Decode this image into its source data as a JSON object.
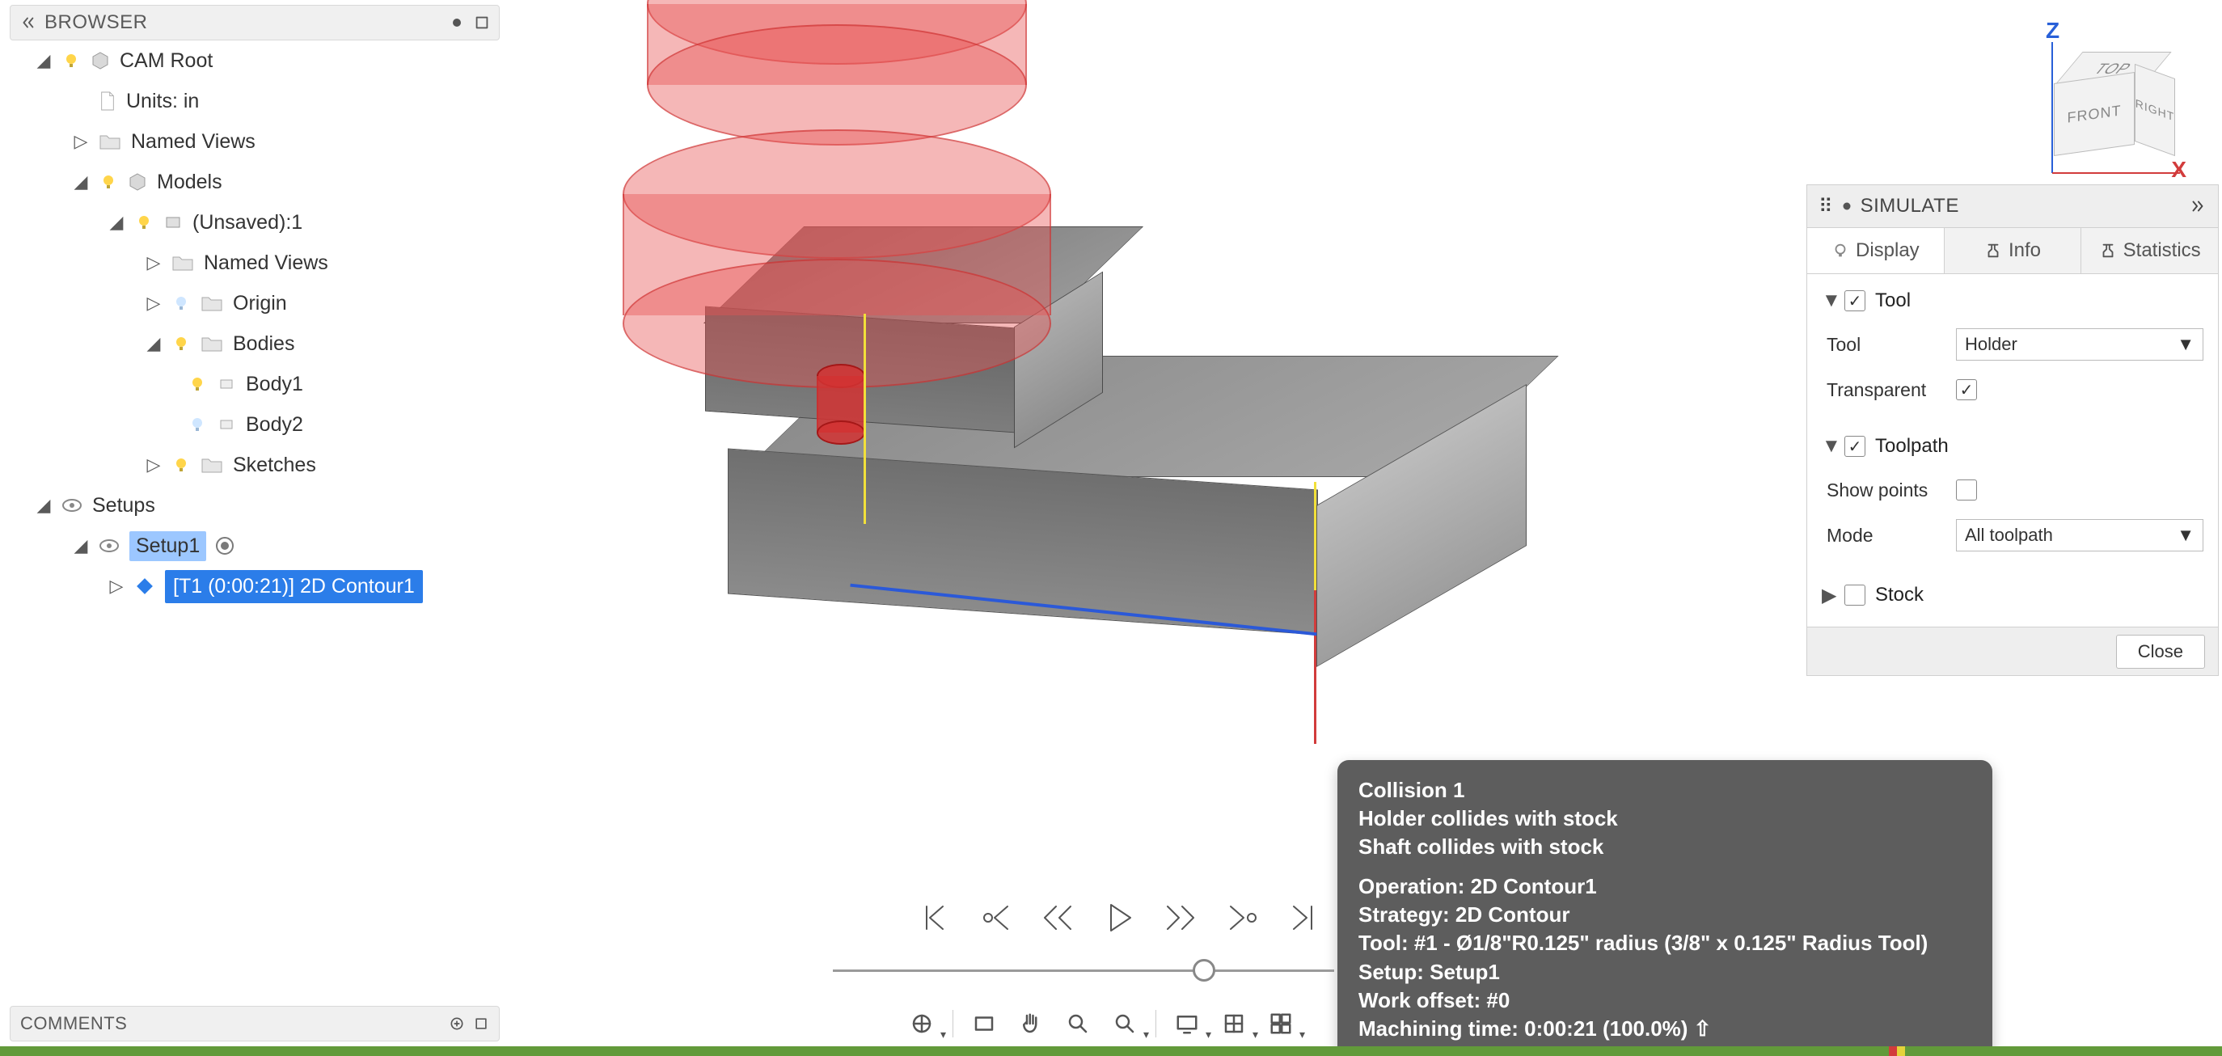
{
  "browser": {
    "title": "BROWSER",
    "tree": {
      "root": "CAM Root",
      "units": "Units: in",
      "named_views": "Named Views",
      "models": "Models",
      "unsaved": "(Unsaved):1",
      "named_views2": "Named Views",
      "origin": "Origin",
      "bodies": "Bodies",
      "body1": "Body1",
      "body2": "Body2",
      "sketches": "Sketches",
      "setups": "Setups",
      "setup1": "Setup1",
      "op1": "[T1 (0:00:21)] 2D Contour1"
    }
  },
  "comments": {
    "title": "COMMENTS"
  },
  "viewcube": {
    "front": "FRONT",
    "right": "RIGHT",
    "top": "TOP",
    "z": "Z",
    "x": "X"
  },
  "simulate": {
    "title": "SIMULATE",
    "tabs": {
      "display": "Display",
      "info": "Info",
      "stats": "Statistics"
    },
    "tool_section": "Tool",
    "tool_label": "Tool",
    "tool_value": "Holder",
    "transparent_label": "Transparent",
    "toolpath_section": "Toolpath",
    "showpoints_label": "Show points",
    "mode_label": "Mode",
    "mode_value": "All toolpath",
    "stock_section": "Stock",
    "close": "Close"
  },
  "tooltip": {
    "title": "Collision 1",
    "l1": "Holder collides with stock",
    "l2": "Shaft collides with stock",
    "op": "Operation: 2D Contour1",
    "strat": "Strategy: 2D Contour",
    "tool": "Tool: #1 - Ø1/8\"R0.125\" radius (3/8\" x 0.125\" Radius Tool)",
    "setup": "Setup: Setup1",
    "offset": "Work offset: #0",
    "time": "Machining time: 0:00:21 (100.0%) ⇧"
  }
}
